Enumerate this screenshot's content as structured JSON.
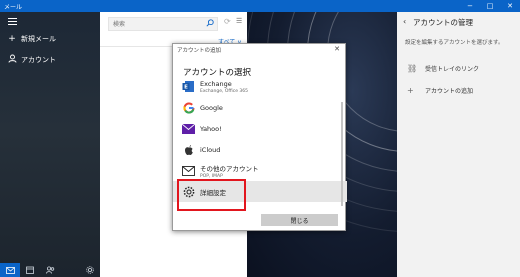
{
  "titlebar": {
    "title": "メール"
  },
  "leftpane": {
    "new_mail": "新規メール",
    "accounts": "アカウント"
  },
  "mid": {
    "search_placeholder": "検索",
    "filter": "すべて ∨"
  },
  "rightpane": {
    "title": "アカウントの管理",
    "desc": "設定を編集するアカウントを選びます。",
    "link_inbox": "受信トレイのリンク",
    "add_account": "アカウントの追加"
  },
  "dialog": {
    "title": "アカウントの追加",
    "heading": "アカウントの選択",
    "accounts": [
      {
        "name": "Exchange",
        "sub": "Exchange, Office 365"
      },
      {
        "name": "Google",
        "sub": ""
      },
      {
        "name": "Yahoo!",
        "sub": ""
      },
      {
        "name": "iCloud",
        "sub": ""
      },
      {
        "name": "その他のアカウント",
        "sub": "POP, IMAP"
      }
    ],
    "advanced": "詳細設定",
    "close_button": "閉じる"
  },
  "colors": {
    "accent": "#0a64c8",
    "highlight": "#e2161e",
    "titlebar": "#0a64c8"
  },
  "icons": [
    "hamburger-icon",
    "plus-icon",
    "person-icon",
    "search-icon",
    "sync-icon",
    "filter-icon",
    "back-icon",
    "link-icon",
    "plus-icon",
    "exchange-logo",
    "google-logo",
    "yahoo-logo",
    "icloud-logo",
    "mail-icon",
    "gear-icon",
    "mail-nav-icon",
    "calendar-icon",
    "people-icon",
    "settings-icon"
  ]
}
